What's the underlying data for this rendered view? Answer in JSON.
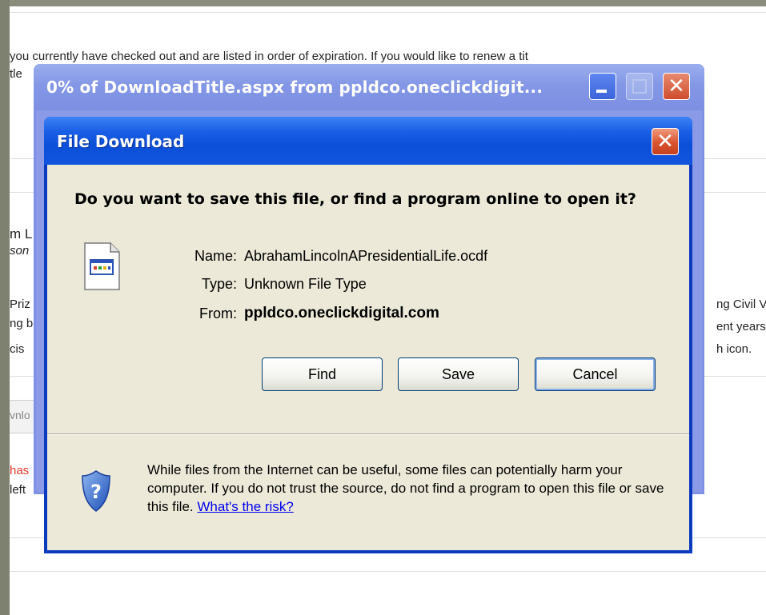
{
  "background_page": {
    "line1": "you currently have checked out and are listed in order of expiration. If you would like to renew a tit",
    "line2": "tle",
    "title_frag": "m L",
    "author_frag": "son",
    "left_frags": [
      "Priz",
      "ng b",
      "cis"
    ],
    "right_frags": [
      "ng Civil V",
      "ent years",
      "h icon."
    ],
    "button_frag": "vnlo",
    "red_frag": "has",
    "left_frag2": "left"
  },
  "progress_window": {
    "title": "0% of DownloadTitle.aspx from ppldco.oneclickdigit...",
    "min_icon": "minimize-icon",
    "max_icon": "maximize-icon",
    "close_icon": "close-icon"
  },
  "dialog": {
    "title": "File Download",
    "question": "Do you want to save this file, or find a program online to open it?",
    "name_label": "Name:",
    "name_value": "AbrahamLincolnAPresidentialLife.ocdf",
    "type_label": "Type:",
    "type_value": "Unknown File Type",
    "from_label": "From:",
    "from_value": "ppldco.oneclickdigital.com",
    "buttons": {
      "find": "Find",
      "save": "Save",
      "cancel": "Cancel"
    },
    "warning": "While files from the Internet can be useful, some files can potentially harm your computer. If you do not trust the source, do not find a program to open this file or save this file.",
    "risk_link": "What's the risk?",
    "file_icon": "file-icon",
    "shield_icon": "shield-question-icon"
  },
  "colors": {
    "titlebar_blue": "#0b4fd9",
    "dialog_face": "#ece9d8",
    "close_red": "#d9542f",
    "link": "#0000ee"
  }
}
